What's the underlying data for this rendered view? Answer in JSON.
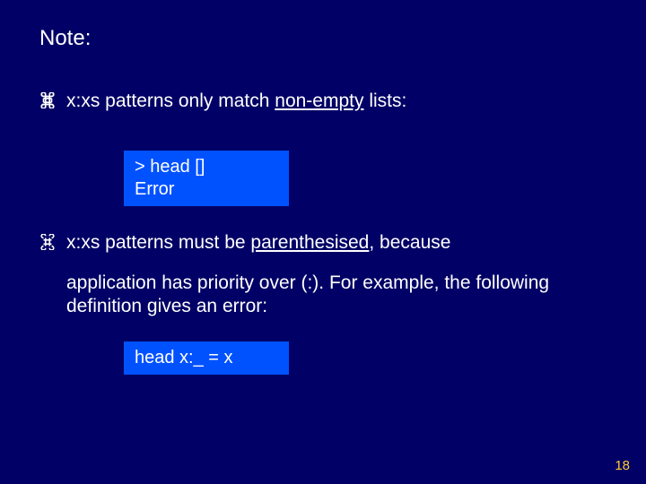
{
  "heading": "Note:",
  "bullets": [
    {
      "pre": "x:xs patterns only match ",
      "underlined": "non-empty",
      "post": " lists:"
    },
    {
      "pre": "x:xs patterns must be ",
      "underlined": "parenthesised",
      "post": ", because"
    }
  ],
  "continuation": "application has priority over (:).  For example, the following definition gives an error:",
  "code1": {
    "line1": "> head []",
    "line2": "Error"
  },
  "code2": {
    "line1": "head x:_ = x"
  },
  "page_number": "18"
}
